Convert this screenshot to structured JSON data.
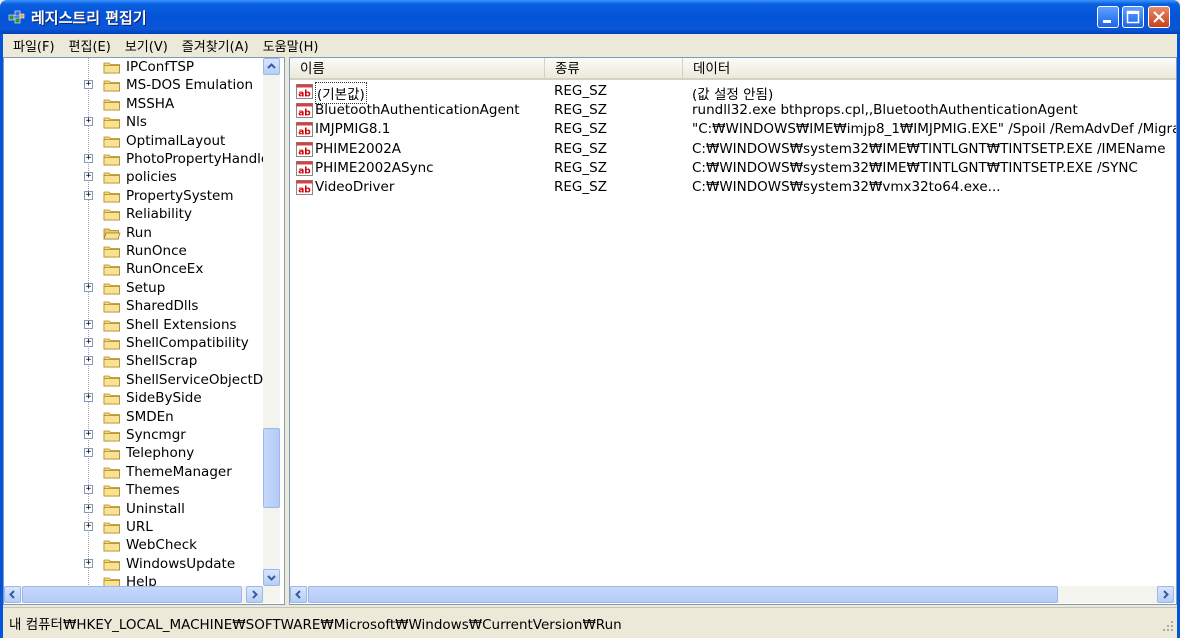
{
  "window": {
    "title": "레지스트리 편집기"
  },
  "menu": [
    {
      "label": "파일(F)"
    },
    {
      "label": "편집(E)"
    },
    {
      "label": "보기(V)"
    },
    {
      "label": "즐겨찾기(A)"
    },
    {
      "label": "도움말(H)"
    }
  ],
  "tree": {
    "items": [
      {
        "label": "IPConfTSP",
        "expandable": false
      },
      {
        "label": "MS-DOS Emulation",
        "expandable": true
      },
      {
        "label": "MSSHA",
        "expandable": false
      },
      {
        "label": "Nls",
        "expandable": true
      },
      {
        "label": "OptimalLayout",
        "expandable": false
      },
      {
        "label": "PhotoPropertyHandle",
        "expandable": true
      },
      {
        "label": "policies",
        "expandable": true
      },
      {
        "label": "PropertySystem",
        "expandable": true
      },
      {
        "label": "Reliability",
        "expandable": false
      },
      {
        "label": "Run",
        "expandable": false,
        "selected": true
      },
      {
        "label": "RunOnce",
        "expandable": false
      },
      {
        "label": "RunOnceEx",
        "expandable": false
      },
      {
        "label": "Setup",
        "expandable": true
      },
      {
        "label": "SharedDlls",
        "expandable": false
      },
      {
        "label": "Shell Extensions",
        "expandable": true
      },
      {
        "label": "ShellCompatibility",
        "expandable": true
      },
      {
        "label": "ShellScrap",
        "expandable": true
      },
      {
        "label": "ShellServiceObjectDe",
        "expandable": false
      },
      {
        "label": "SideBySide",
        "expandable": true
      },
      {
        "label": "SMDEn",
        "expandable": false
      },
      {
        "label": "Syncmgr",
        "expandable": true
      },
      {
        "label": "Telephony",
        "expandable": true
      },
      {
        "label": "ThemeManager",
        "expandable": false
      },
      {
        "label": "Themes",
        "expandable": true
      },
      {
        "label": "Uninstall",
        "expandable": true
      },
      {
        "label": "URL",
        "expandable": true
      },
      {
        "label": "WebCheck",
        "expandable": false
      },
      {
        "label": "WindowsUpdate",
        "expandable": true
      },
      {
        "label": "Help",
        "expandable": false
      }
    ]
  },
  "list": {
    "columns": [
      "이름",
      "종류",
      "데이터"
    ],
    "rows": [
      {
        "name": "(기본값)",
        "type": "REG_SZ",
        "data": "(값 설정 안됨)"
      },
      {
        "name": "BluetoothAuthenticationAgent",
        "type": "REG_SZ",
        "data": "rundll32.exe bthprops.cpl,,BluetoothAuthenticationAgent"
      },
      {
        "name": "IMJPMIG8.1",
        "type": "REG_SZ",
        "data": "\"C:₩WINDOWS₩IME₩imjp8_1₩IMJPMIG.EXE\" /Spoil /RemAdvDef /Migra"
      },
      {
        "name": "PHIME2002A",
        "type": "REG_SZ",
        "data": "C:₩WINDOWS₩system32₩IME₩TINTLGNT₩TINTSETP.EXE /IMEName"
      },
      {
        "name": "PHIME2002ASync",
        "type": "REG_SZ",
        "data": "C:₩WINDOWS₩system32₩IME₩TINTLGNT₩TINTSETP.EXE /SYNC"
      },
      {
        "name": "VideoDriver",
        "type": "REG_SZ",
        "data": "C:₩WINDOWS₩system32₩vmx32to64.exe..."
      }
    ]
  },
  "statusbar": {
    "path": "내 컴퓨터₩HKEY_LOCAL_MACHINE₩SOFTWARE₩Microsoft₩Windows₩CurrentVersion₩Run"
  },
  "icons": {
    "value": "string-value-icon",
    "folder": "folder-icon",
    "app": "registry-editor-icon"
  }
}
